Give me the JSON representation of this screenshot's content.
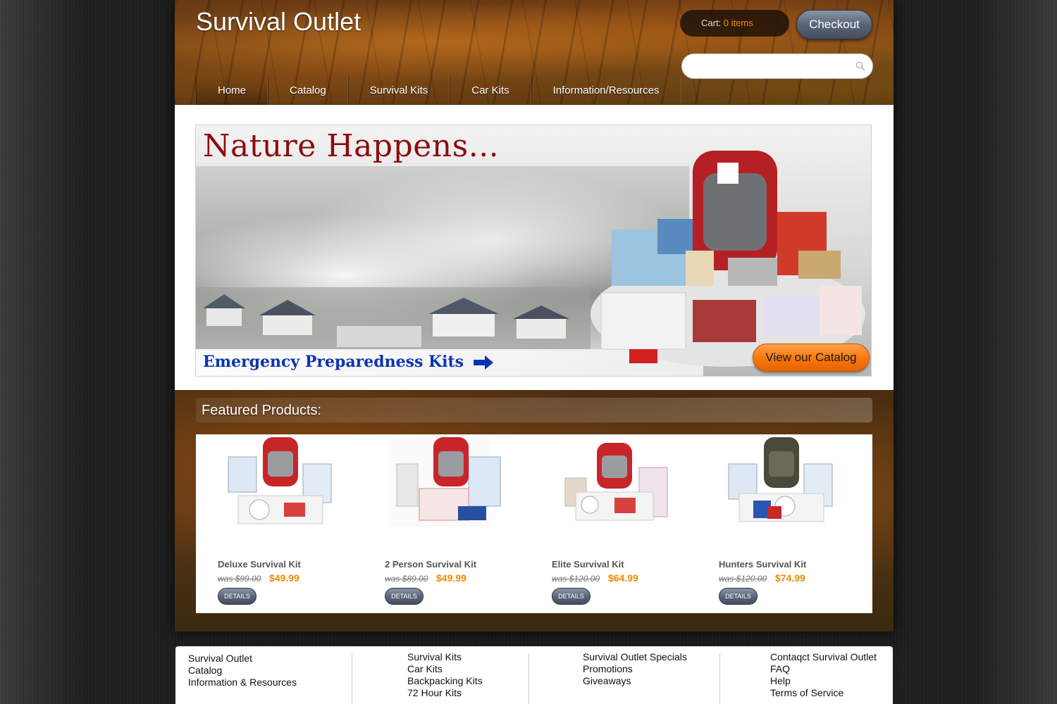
{
  "header": {
    "site_title": "Survival Outlet",
    "cart_label": "Cart:",
    "cart_count": "0 items",
    "checkout_label": "Checkout",
    "search_placeholder": ""
  },
  "nav": {
    "items": [
      {
        "label": "Home"
      },
      {
        "label": "Catalog"
      },
      {
        "label": "Survival Kits"
      },
      {
        "label": "Car Kits"
      },
      {
        "label": "Information/Resources"
      }
    ]
  },
  "banner": {
    "headline": "Nature Happens...",
    "subheadline": "Emergency Preparedness Kits",
    "cta_label": "View our Catalog"
  },
  "featured": {
    "title": "Featured Products:",
    "products": [
      {
        "name": "Deluxe Survival Kit",
        "was": "was $99.00",
        "price": "$49.99",
        "details": "DETAILS",
        "pack_color": "#c8252a"
      },
      {
        "name": "2 Person Survival Kit",
        "was": "was $89.00",
        "price": "$49.99",
        "details": "DETAILS",
        "pack_color": "#c8252a"
      },
      {
        "name": "Elite Survival Kit",
        "was": "was $120.00",
        "price": "$64.99",
        "details": "DETAILS",
        "pack_color": "#c8252a"
      },
      {
        "name": "Hunters Survival Kit",
        "was": "was $120.00",
        "price": "$74.99",
        "details": "DETAILS",
        "pack_color": "#4a4a3a"
      }
    ]
  },
  "footer": {
    "col1": [
      "Survival Outlet",
      "Catalog",
      "Information & Resources"
    ],
    "col2": [
      "Survival Kits",
      "Car Kits",
      "Backpacking Kits",
      "72 Hour Kits"
    ],
    "col3": [
      "Survival Outlet Specials",
      "Promotions",
      "Giveaways"
    ],
    "col4": [
      "Contaqct Survival Outlet",
      "FAQ",
      "Help",
      "Terms of Service"
    ]
  },
  "colors": {
    "accent_orange": "#f28a00",
    "headline_red": "#8c0c0c",
    "sub_blue": "#0b34b0"
  }
}
